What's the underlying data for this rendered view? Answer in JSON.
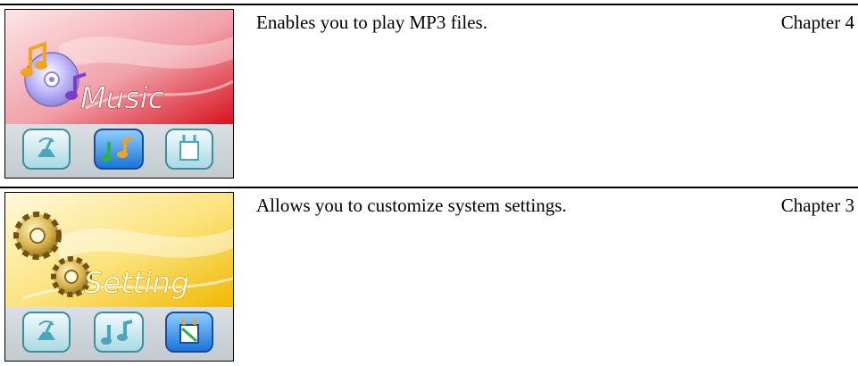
{
  "rows": [
    {
      "screen_title": "Music",
      "description": "Enables you to play MP3 files.",
      "chapter": "Chapter 4",
      "selected_icon": "music-icon",
      "theme": {
        "top": "#e0283a",
        "bottom": "#f6c2c6",
        "text": "#ffffff"
      }
    },
    {
      "screen_title": "Setting",
      "description": "Allows you to customize system settings.",
      "chapter": "Chapter 3",
      "selected_icon": "settings-icon",
      "theme": {
        "top": "#f4c917",
        "bottom": "#fdf2b4",
        "text": "#ffffff"
      }
    }
  ],
  "menu_icons": [
    "radio-icon",
    "music-icon",
    "settings-icon"
  ]
}
